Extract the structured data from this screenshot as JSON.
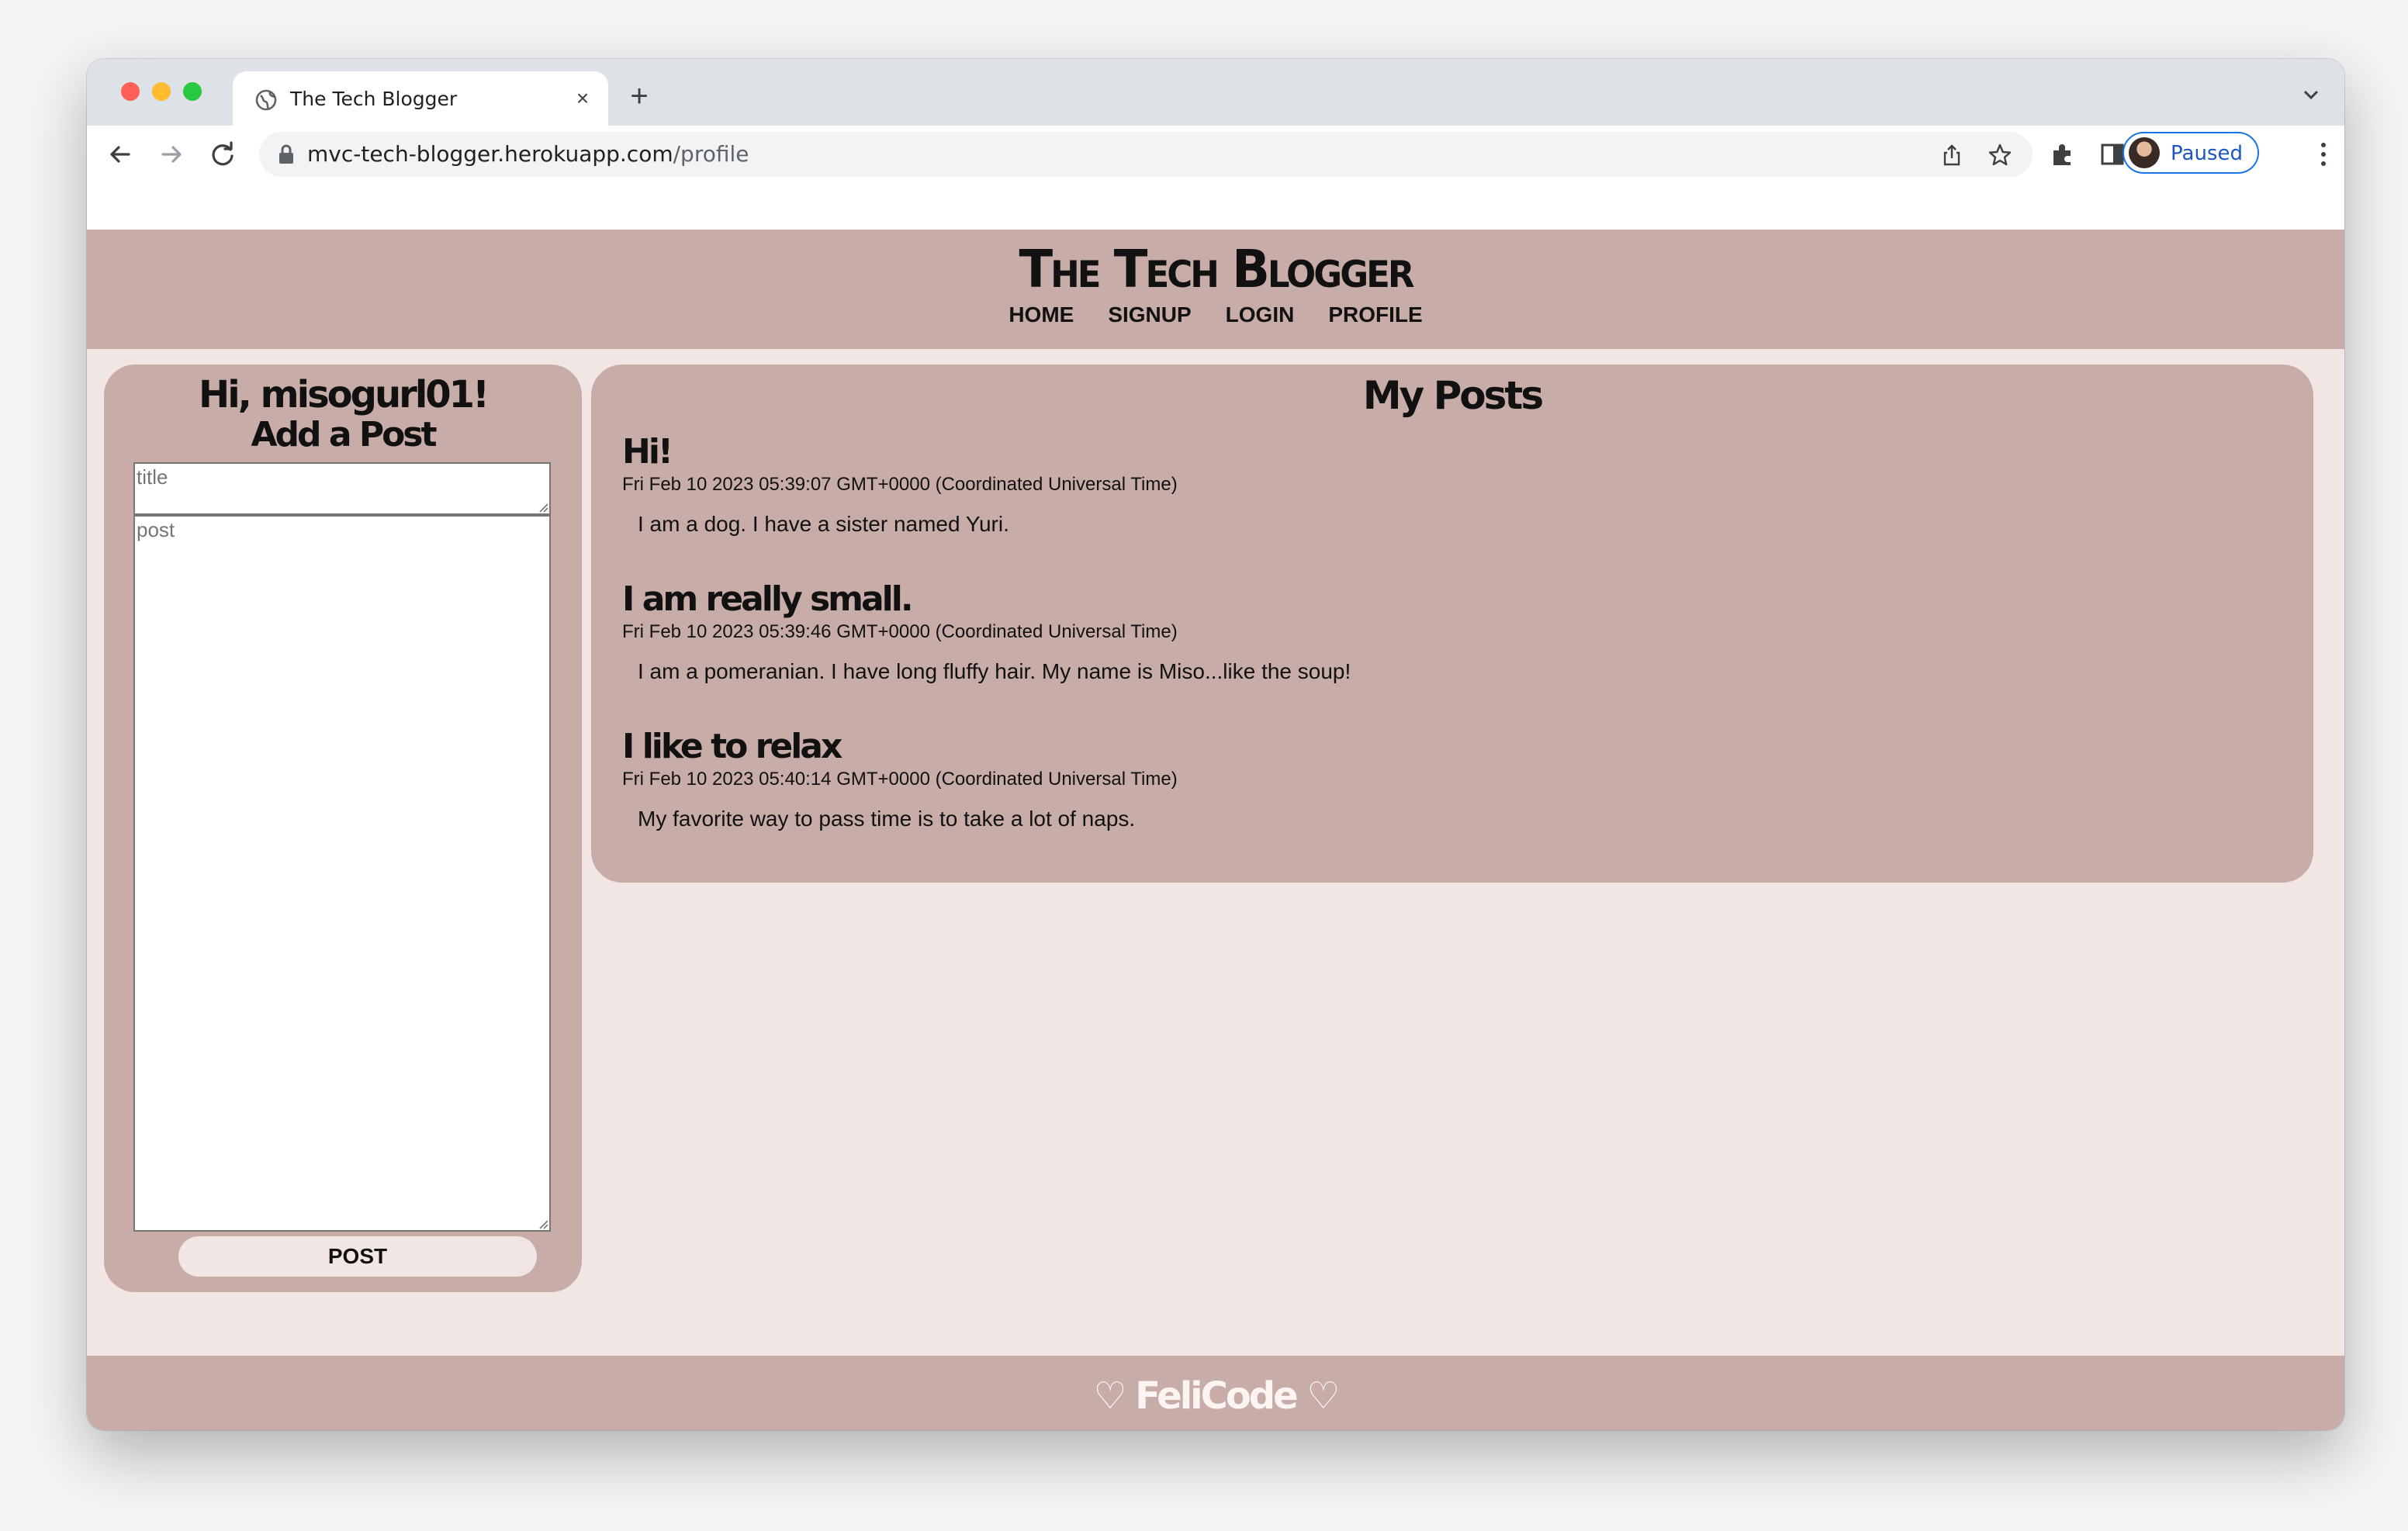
{
  "browser": {
    "tab_title": "The Tech Blogger",
    "new_tab_symbol": "+",
    "close_symbol": "×",
    "url_host": "mvc-tech-blogger.herokuapp.com",
    "url_path": "/profile",
    "profile_status": "Paused",
    "icons": [
      "globe-icon",
      "back-icon",
      "forward-icon",
      "reload-icon",
      "lock-icon",
      "share-icon",
      "star-icon",
      "extensions-icon",
      "side-panel-icon",
      "menu-icon",
      "tab-list-icon"
    ]
  },
  "site": {
    "title": "The Tech Blogger",
    "nav": [
      "HOME",
      "SIGNUP",
      "LOGIN",
      "PROFILE"
    ]
  },
  "sidebar": {
    "greeting": "Hi, misogurl01!",
    "heading": "Add a Post",
    "title_placeholder": "title",
    "post_placeholder": "post",
    "submit_label": "POST"
  },
  "posts_section": {
    "heading": "My Posts",
    "posts": [
      {
        "title": "Hi!",
        "date": "Fri Feb 10 2023 05:39:07 GMT+0000 (Coordinated Universal Time)",
        "body": "I am a dog. I have a sister named Yuri."
      },
      {
        "title": "I am really small.",
        "date": "Fri Feb 10 2023 05:39:46 GMT+0000 (Coordinated Universal Time)",
        "body": "I am a pomeranian. I have long fluffy hair. My name is Miso...like the soup!"
      },
      {
        "title": "I like to relax",
        "date": "Fri Feb 10 2023 05:40:14 GMT+0000 (Coordinated Universal Time)",
        "body": "My favorite way to pass time is to take a lot of naps."
      }
    ]
  },
  "footer": {
    "text": "♡ FeliCode ♡"
  },
  "colors": {
    "panel": "#c8aca8",
    "background": "#f1e6e3",
    "footer_text": "#fbf4f2"
  }
}
